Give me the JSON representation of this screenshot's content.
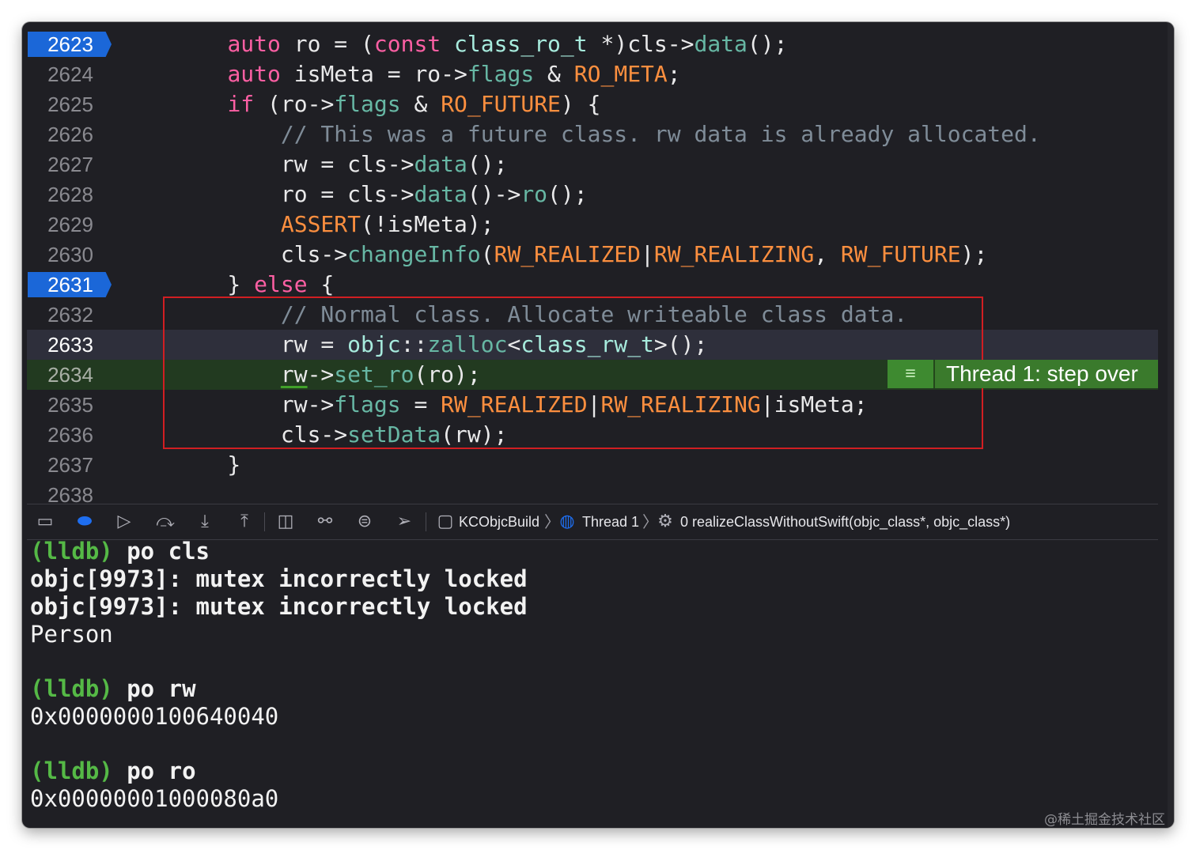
{
  "editor": {
    "lines": [
      {
        "num": "2623",
        "segs": [
          [
            "    ",
            "pl"
          ],
          [
            "auto",
            "kw"
          ],
          [
            " ro = (",
            "pl"
          ],
          [
            "const",
            "kw"
          ],
          [
            " ",
            "pl"
          ],
          [
            "class_ro_t",
            "tp"
          ],
          [
            " *)cls->",
            "pl"
          ],
          [
            "data",
            "fn"
          ],
          [
            "();",
            "pl"
          ]
        ]
      },
      {
        "num": "2624",
        "segs": [
          [
            "    ",
            "pl"
          ],
          [
            "auto",
            "kw"
          ],
          [
            " isMeta = ro->",
            "pl"
          ],
          [
            "flags",
            "fn"
          ],
          [
            " & ",
            "pl"
          ],
          [
            "RO_META",
            "mac"
          ],
          [
            ";",
            "pl"
          ]
        ]
      },
      {
        "num": "2625",
        "segs": [
          [
            "    ",
            "pl"
          ],
          [
            "if",
            "kw"
          ],
          [
            " (ro->",
            "pl"
          ],
          [
            "flags",
            "fn"
          ],
          [
            " & ",
            "pl"
          ],
          [
            "RO_FUTURE",
            "mac"
          ],
          [
            ") {",
            "pl"
          ]
        ]
      },
      {
        "num": "2626",
        "segs": [
          [
            "        ",
            "pl"
          ],
          [
            "// This was a future class. rw data is already allocated.",
            "cm"
          ]
        ]
      },
      {
        "num": "2627",
        "segs": [
          [
            "        rw = cls->",
            "pl"
          ],
          [
            "data",
            "fn"
          ],
          [
            "();",
            "pl"
          ]
        ]
      },
      {
        "num": "2628",
        "segs": [
          [
            "        ro = cls->",
            "pl"
          ],
          [
            "data",
            "fn"
          ],
          [
            "()->",
            "pl"
          ],
          [
            "ro",
            "fn"
          ],
          [
            "();",
            "pl"
          ]
        ]
      },
      {
        "num": "2629",
        "segs": [
          [
            "        ",
            "pl"
          ],
          [
            "ASSERT",
            "mac"
          ],
          [
            "(!isMeta);",
            "pl"
          ]
        ]
      },
      {
        "num": "2630",
        "segs": [
          [
            "        cls->",
            "pl"
          ],
          [
            "changeInfo",
            "fn"
          ],
          [
            "(",
            "pl"
          ],
          [
            "RW_REALIZED",
            "mac"
          ],
          [
            "|",
            "pl"
          ],
          [
            "RW_REALIZING",
            "mac"
          ],
          [
            ", ",
            "pl"
          ],
          [
            "RW_FUTURE",
            "mac"
          ],
          [
            ");",
            "pl"
          ]
        ]
      },
      {
        "num": "2631",
        "segs": [
          [
            "    } ",
            "pl"
          ],
          [
            "else",
            "kw"
          ],
          [
            " {",
            "pl"
          ]
        ]
      },
      {
        "num": "2632",
        "segs": [
          [
            "        ",
            "pl"
          ],
          [
            "// Normal class. Allocate writeable class data.",
            "cm"
          ]
        ]
      },
      {
        "num": "2633",
        "segs": [
          [
            "        rw = ",
            "pl"
          ],
          [
            "objc",
            "tp"
          ],
          [
            "::",
            "pl"
          ],
          [
            "zalloc",
            "fn"
          ],
          [
            "<",
            "pl"
          ],
          [
            "class_rw_t",
            "tp"
          ],
          [
            ">();",
            "pl"
          ]
        ]
      },
      {
        "num": "2634",
        "segs": [
          [
            "        ",
            "pl"
          ],
          [
            "rw",
            "ul"
          ],
          [
            "->",
            "pl"
          ],
          [
            "set_ro",
            "fn"
          ],
          [
            "(ro);",
            "pl"
          ]
        ]
      },
      {
        "num": "2635",
        "segs": [
          [
            "        rw->",
            "pl"
          ],
          [
            "flags",
            "fn"
          ],
          [
            " = ",
            "pl"
          ],
          [
            "RW_REALIZED",
            "mac"
          ],
          [
            "|",
            "pl"
          ],
          [
            "RW_REALIZING",
            "mac"
          ],
          [
            "|isMeta;",
            "pl"
          ]
        ]
      },
      {
        "num": "2636",
        "segs": [
          [
            "        cls->",
            "pl"
          ],
          [
            "setData",
            "fn"
          ],
          [
            "(rw);",
            "pl"
          ]
        ]
      },
      {
        "num": "2637",
        "segs": [
          [
            "    }",
            "pl"
          ]
        ]
      },
      {
        "num": "2638",
        "segs": []
      }
    ],
    "annotation": {
      "text": "Thread 1: step over",
      "icon": "lines-icon"
    }
  },
  "toolbar": {
    "breadcrumbs": {
      "project": "KCObjcBuild",
      "thread": "Thread 1",
      "frame": "0 realizeClassWithoutSwift(objc_class*, objc_class*)"
    }
  },
  "console": {
    "prompt1": "(lldb)",
    "cmd1": " po cls",
    "out1": "objc[9973]: mutex incorrectly locked",
    "out2": "objc[9973]: mutex incorrectly locked",
    "out3": "Person",
    "prompt2": "(lldb)",
    "cmd2": " po rw",
    "out4": "0x0000000100640040",
    "prompt3": "(lldb)",
    "cmd3": " po ro",
    "out5": "0x00000001000080a0"
  },
  "watermark": "@稀土掘金技术社区",
  "colors": {
    "keyword": "#fc5fa3",
    "function": "#67b7a4",
    "macro": "#fd8f3f",
    "comment": "#7f8c98",
    "type": "#a7ebdd",
    "breakpoint": "#1b67d8",
    "pc_line": "#223a20",
    "prompt": "#55b946",
    "redbox": "#d11e22"
  }
}
